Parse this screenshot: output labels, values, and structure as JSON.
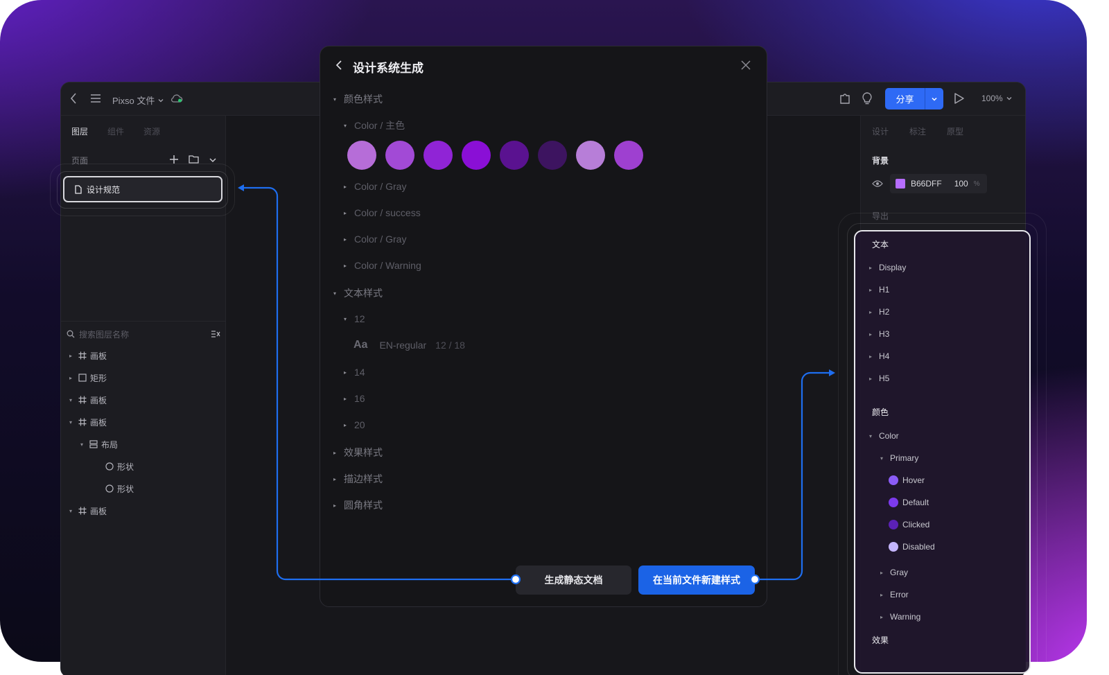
{
  "app": {
    "file_menu": "Pixso 文件",
    "share_label": "分享",
    "zoom": "100%"
  },
  "left": {
    "tabs": [
      "图层",
      "组件",
      "资源"
    ],
    "pages_label": "页面",
    "current_page": "设计规范",
    "search_placeholder": "搜索图层名称",
    "layers": [
      {
        "name": "画板",
        "icon": "frame-icon",
        "arrow": "collapsed"
      },
      {
        "name": "矩形",
        "icon": "rectangle-icon",
        "arrow": "collapsed"
      },
      {
        "name": "画板",
        "icon": "frame-icon",
        "arrow": "expanded"
      },
      {
        "name": "画板",
        "icon": "frame-icon",
        "arrow": "expanded"
      },
      {
        "name": "布局",
        "icon": "layout-icon",
        "arrow": "expanded"
      },
      {
        "name": "形状",
        "icon": "ellipse-icon",
        "arrow": "none"
      },
      {
        "name": "形状",
        "icon": "ellipse-icon",
        "arrow": "none"
      },
      {
        "name": "画板",
        "icon": "frame-icon",
        "arrow": "expanded"
      }
    ]
  },
  "right": {
    "tabs": [
      "设计",
      "标注",
      "原型"
    ],
    "background_label": "背景",
    "fill_hex": "B66DFF",
    "fill_opacity": "100",
    "fill_unit": "%",
    "fill_color": "#B66DFF",
    "export_label": "导出"
  },
  "styles_panel": {
    "text_header": "文本",
    "text_items": [
      "Display",
      "H1",
      "H2",
      "H3",
      "H4",
      "H5"
    ],
    "color_header": "颜色",
    "color_group": "Color",
    "primary_group": "Primary",
    "primary_items": [
      {
        "name": "Hover",
        "color": "#8B5CF6"
      },
      {
        "name": "Default",
        "color": "#7C3AED"
      },
      {
        "name": "Clicked",
        "color": "#5B21B6"
      },
      {
        "name": "Disabled",
        "color": "#C4B5FD"
      }
    ],
    "other_groups": [
      "Gray",
      "Error",
      "Warning"
    ],
    "effect_header": "效果"
  },
  "modal": {
    "title": "设计系统生成",
    "color_styles": "颜色样式",
    "color_primary": "Color / 主色",
    "swatches": [
      "#B66DD8",
      "#A24AD6",
      "#9024D6",
      "#8A0FD6",
      "#5A1290",
      "#3D1460",
      "#B77ED8",
      "#9E40D0"
    ],
    "color_groups": [
      "Color / Gray",
      "Color / success",
      "Color / Gray",
      "Color / Warning"
    ],
    "text_styles": "文本样式",
    "size_12": "12",
    "sample_glyph": "Aa",
    "sample_name": "EN-regular",
    "sample_metrics": "12 / 18",
    "sizes": [
      "14",
      "16",
      "20"
    ],
    "effect_styles": "效果样式",
    "stroke_styles": "描边样式",
    "radius_styles": "圆角样式",
    "btn_static": "生成静态文档",
    "btn_new": "在当前文件新建样式"
  }
}
